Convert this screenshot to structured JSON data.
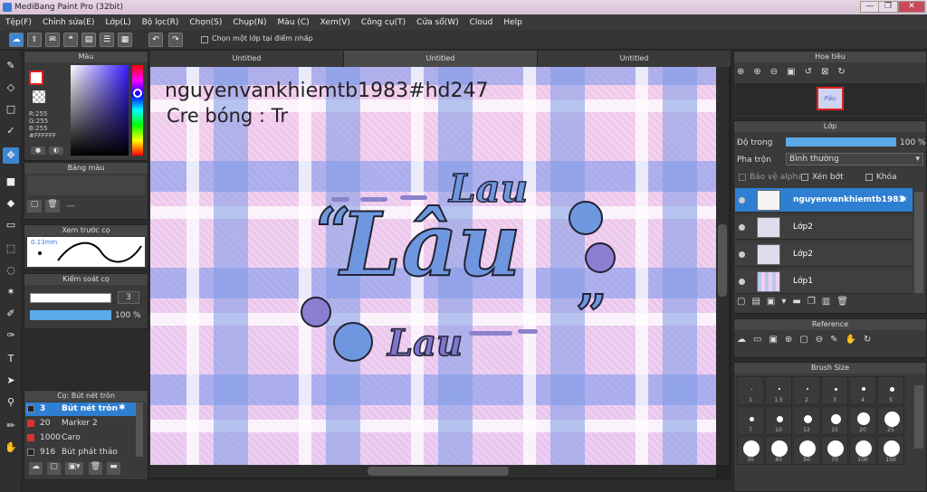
{
  "window": {
    "title": "MediBang Paint Pro (32bit)",
    "minimize": "—",
    "maximize": "❐",
    "close": "✕"
  },
  "menu": [
    "Tệp(F)",
    "Chỉnh sửa(E)",
    "Lớp(L)",
    "Bộ lọc(R)",
    "Chọn(S)",
    "Chụp(N)",
    "Màu (C)",
    "Xem(V)",
    "Công cụ(T)",
    "Cửa sổ(W)",
    "Cloud",
    "Help"
  ],
  "toolbar": {
    "checkbox_label": "Chọn một lớp tại điểm nhấp"
  },
  "color_panel": {
    "title": "Màu",
    "r": "R:255",
    "g": "G:255",
    "b": "B:255",
    "hex": "#FFFFFF"
  },
  "palette_panel": {
    "title": "Bảng màu",
    "value": "---"
  },
  "brush_preview": {
    "title": "Xem trước cọ",
    "size": "0.13mm"
  },
  "control_panel": {
    "title": "Kiểm soát cọ",
    "size": "3",
    "opacity": "100 %"
  },
  "brush_list": {
    "title": "Cọ: Bút nét tròn",
    "items": [
      {
        "size": "3",
        "name": "Bút nét tròn",
        "color": "#222222"
      },
      {
        "size": "20",
        "name": "Marker 2",
        "color": "#e03030"
      },
      {
        "size": "1000",
        "name": "Caro",
        "color": "#e03030"
      },
      {
        "size": "916",
        "name": "Bút phát thảo",
        "color": "#222222"
      }
    ]
  },
  "tabs": [
    "Untitled",
    "Untitled",
    "Untitled"
  ],
  "artwork": {
    "line1": "nguyenvankhiemtb1983#hd247",
    "line2": "Cre bóng : Tr",
    "word_top": "Lau",
    "word_main": "Lâu",
    "word_bottom": "Lau",
    "quote_open": "“",
    "quote_close": "”"
  },
  "navigator": {
    "title": "Hoa tiêu",
    "thumb_text": "Pâu"
  },
  "layers_panel": {
    "title": "Lớp",
    "opacity_label": "Độ trong",
    "opacity_value": "100 %",
    "opacity_level": 1.0,
    "blend_label": "Pha trộn",
    "blend_value": "Bình thường",
    "protect_alpha": "Bảo vệ alpha",
    "clip": "Xén bớt",
    "lock": "Khóa",
    "layers": [
      {
        "name": "nguyenvankhiemtb1983",
        "selected": true
      },
      {
        "name": "Lớp2",
        "selected": false
      },
      {
        "name": "Lớp2",
        "selected": false
      },
      {
        "name": "Lớp1",
        "selected": false
      }
    ]
  },
  "reference": {
    "title": "Reference"
  },
  "brush_size": {
    "title": "Brush Size",
    "labels": [
      "1",
      "1.5",
      "2",
      "3",
      "4",
      "5",
      "7",
      "10",
      "12",
      "15",
      "20",
      "25",
      "30",
      "40",
      "50",
      "70",
      "100",
      "150"
    ]
  }
}
